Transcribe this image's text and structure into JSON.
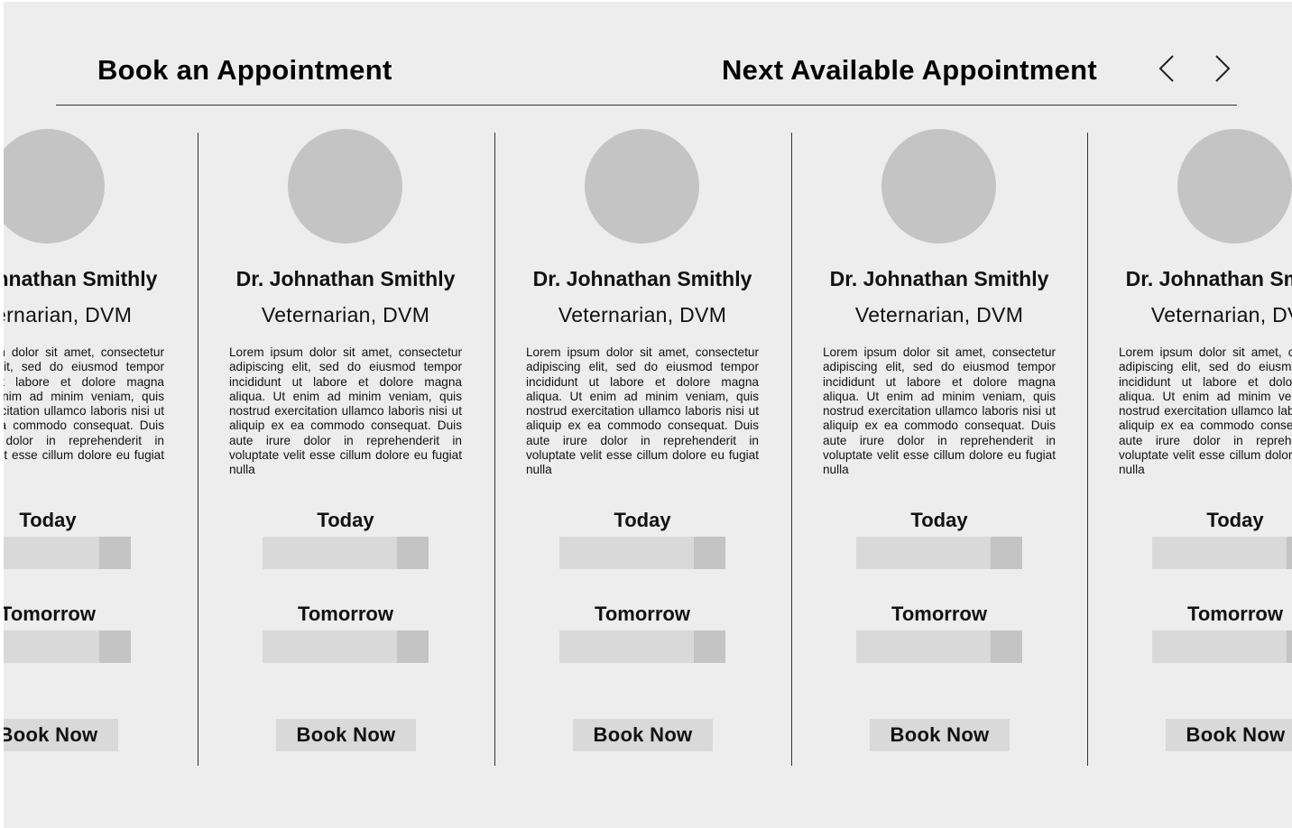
{
  "header": {
    "title": "Book an Appointment",
    "subtitle": "Next Available Appointment",
    "prev_icon": "chevron-left-icon",
    "next_icon": "chevron-right-icon"
  },
  "cards": [
    {
      "name": "Dr. Johnathan Smithly",
      "title": "Veternarian, DVM",
      "description": "Lorem ipsum dolor sit amet, consectetur adipiscing elit, sed do eiusmod tempor incididunt ut labore et dolore magna aliqua. Ut enim ad minim veniam, quis nostrud exercitation ullamco laboris nisi ut aliquip ex ea commodo consequat. Duis aute irure dolor in reprehenderit in voluptate velit esse cillum dolore eu fugiat nulla",
      "today_label": "Today",
      "tomorrow_label": "Tomorrow",
      "book_label": "Book Now"
    },
    {
      "name": "Dr. Johnathan Smithly",
      "title": "Veternarian, DVM",
      "description": "Lorem ipsum dolor sit amet, consectetur adipiscing elit, sed do eiusmod tempor incididunt ut labore et dolore magna aliqua. Ut enim ad minim veniam, quis nostrud exercitation ullamco laboris nisi ut aliquip ex ea commodo consequat. Duis aute irure dolor in reprehenderit in voluptate velit esse cillum dolore eu fugiat nulla",
      "today_label": "Today",
      "tomorrow_label": "Tomorrow",
      "book_label": "Book Now"
    },
    {
      "name": "Dr. Johnathan Smithly",
      "title": "Veternarian, DVM",
      "description": "Lorem ipsum dolor sit amet, consectetur adipiscing elit, sed do eiusmod tempor incididunt ut labore et dolore magna aliqua. Ut enim ad minim veniam, quis nostrud exercitation ullamco laboris nisi ut aliquip ex ea commodo consequat. Duis aute irure dolor in reprehenderit in voluptate velit esse cillum dolore eu fugiat nulla",
      "today_label": "Today",
      "tomorrow_label": "Tomorrow",
      "book_label": "Book Now"
    },
    {
      "name": "Dr. Johnathan Smithly",
      "title": "Veternarian, DVM",
      "description": "Lorem ipsum dolor sit amet, consectetur adipiscing elit, sed do eiusmod tempor incididunt ut labore et dolore magna aliqua. Ut enim ad minim veniam, quis nostrud exercitation ullamco laboris nisi ut aliquip ex ea commodo consequat. Duis aute irure dolor in reprehenderit in voluptate velit esse cillum dolore eu fugiat nulla",
      "today_label": "Today",
      "tomorrow_label": "Tomorrow",
      "book_label": "Book Now"
    },
    {
      "name": "Dr. Johnathan Smithly",
      "title": "Veternarian, DVM",
      "description": "Lorem ipsum dolor sit amet, consectetur adipiscing elit, sed do eiusmod tempor incididunt ut labore et dolore magna aliqua. Ut enim ad minim veniam, quis nostrud exercitation ullamco laboris nisi ut aliquip ex ea commodo consequat. Duis aute irure dolor in reprehenderit in voluptate velit esse cillum dolore eu fugiat nulla",
      "today_label": "Today",
      "tomorrow_label": "Tomorrow",
      "book_label": "Book Now"
    }
  ],
  "colors": {
    "background": "#ededed",
    "avatar": "#c4c4c4",
    "field": "#d9d9d9",
    "field_toggle": "#c4c4c4",
    "button": "#d9d9d9",
    "rule": "#333333",
    "text": "#111111"
  }
}
